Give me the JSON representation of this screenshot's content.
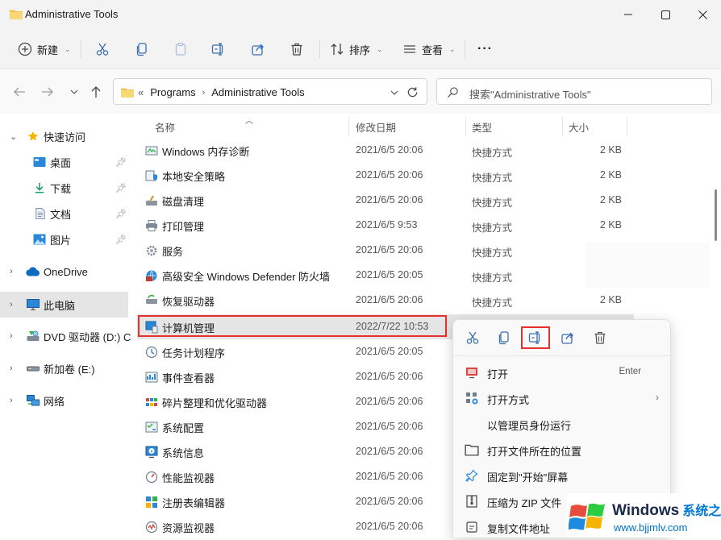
{
  "window": {
    "title": "Administrative Tools"
  },
  "toolbar": {
    "new_label": "新建",
    "sort_label": "排序",
    "view_label": "查看",
    "more_label": "···"
  },
  "address": {
    "overflow": "«",
    "crumbs": [
      "Programs",
      "Administrative Tools"
    ]
  },
  "search": {
    "placeholder": "搜索\"Administrative Tools\""
  },
  "sidebar": {
    "quick_access": "快速访问",
    "desktop": "桌面",
    "downloads": "下载",
    "documents": "文档",
    "pictures": "图片",
    "onedrive": "OneDrive",
    "this_pc": "此电脑",
    "dvd": "DVD 驱动器 (D:) CC",
    "new_volume": "新加卷 (E:)",
    "network": "网络"
  },
  "columns": {
    "name": "名称",
    "date": "修改日期",
    "type": "类型",
    "size": "大小"
  },
  "files": [
    {
      "name": "Windows 内存诊断",
      "date": "2021/6/5 20:06",
      "type": "快捷方式",
      "size": "2 KB"
    },
    {
      "name": "本地安全策略",
      "date": "2021/6/5 20:06",
      "type": "快捷方式",
      "size": "2 KB"
    },
    {
      "name": "磁盘清理",
      "date": "2021/6/5 20:06",
      "type": "快捷方式",
      "size": "2 KB"
    },
    {
      "name": "打印管理",
      "date": "2021/6/5 9:53",
      "type": "快捷方式",
      "size": "2 KB"
    },
    {
      "name": "服务",
      "date": "2021/6/5 20:06",
      "type": "快捷方式",
      "size": ""
    },
    {
      "name": "高级安全 Windows Defender 防火墙",
      "date": "2021/6/5 20:05",
      "type": "快捷方式",
      "size": ""
    },
    {
      "name": "恢复驱动器",
      "date": "2021/6/5 20:06",
      "type": "快捷方式",
      "size": "2 KB"
    },
    {
      "name": "计算机管理",
      "date": "2022/7/22 10:53",
      "type": "",
      "size": ""
    },
    {
      "name": "任务计划程序",
      "date": "2021/6/5 20:05",
      "type": "",
      "size": ""
    },
    {
      "name": "事件查看器",
      "date": "2021/6/5 20:06",
      "type": "",
      "size": ""
    },
    {
      "name": "碎片整理和优化驱动器",
      "date": "2021/6/5 20:06",
      "type": "",
      "size": ""
    },
    {
      "name": "系统配置",
      "date": "2021/6/5 20:06",
      "type": "",
      "size": ""
    },
    {
      "name": "系统信息",
      "date": "2021/6/5 20:06",
      "type": "",
      "size": ""
    },
    {
      "name": "性能监视器",
      "date": "2021/6/5 20:06",
      "type": "",
      "size": ""
    },
    {
      "name": "注册表编辑器",
      "date": "2021/6/5 20:06",
      "type": "",
      "size": ""
    },
    {
      "name": "资源监视器",
      "date": "2021/6/5 20:06",
      "type": "",
      "size": ""
    }
  ],
  "context_menu": {
    "open": "打开",
    "open_shortcut": "Enter",
    "open_with": "打开方式",
    "run_as_admin": "以管理员身份运行",
    "open_location": "打开文件所在的位置",
    "pin_start": "固定到\"开始\"屏幕",
    "compress_zip": "压缩为 ZIP 文件",
    "copy_path": "复制文件地址"
  },
  "watermark": {
    "brand": "Windows",
    "brand_cn": "系统之家",
    "url": "www.bjjmlv.com"
  },
  "colors": {
    "accent": "#0078d4",
    "highlight_box": "#e8302e",
    "selection": "#e5e5e5",
    "folder": "#f2c14e"
  }
}
